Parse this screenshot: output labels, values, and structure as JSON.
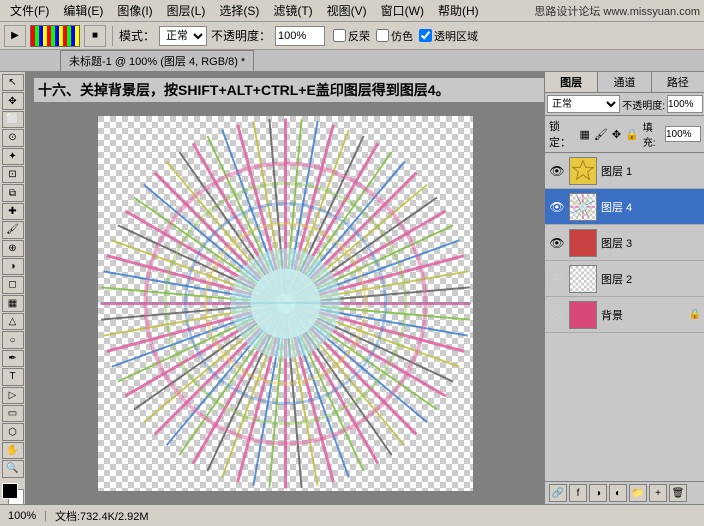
{
  "menubar": {
    "items": [
      "文件(F)",
      "编辑(E)",
      "图像(I)",
      "图层(L)",
      "选择(S)",
      "滤镜(T)",
      "视图(V)",
      "窗口(W)",
      "帮助(H)"
    ],
    "site": "思路设计论坛 www.missyuan.com"
  },
  "toolbar": {
    "mode_label": "模式：",
    "mode_value": "正常",
    "opacity_label": "不透明度：",
    "opacity_value": "100%",
    "checkbox1": "反荣",
    "checkbox2": "仿色",
    "checkbox3": "透明区域"
  },
  "tabbar": {
    "tab": "未标题-1 @ 100% (图层 4, RGB/8) *"
  },
  "instruction": "十六、关掉背景层，按SHIFT+ALT+CTRL+E盖印图层得到图层4。",
  "layers_panel": {
    "tabs": [
      "图层",
      "通道",
      "路径"
    ],
    "active_tab": "图层",
    "blend_mode": "正常",
    "opacity_label": "不透明度：",
    "opacity_value": "100%",
    "lock_label": "锁定：",
    "fill_label": "填充：",
    "fill_value": "100%",
    "layers": [
      {
        "name": "图层 1",
        "visible": true,
        "type": "star",
        "locked": false
      },
      {
        "name": "图层 4",
        "visible": true,
        "type": "layer4",
        "locked": false,
        "active": true
      },
      {
        "name": "图层 3",
        "visible": true,
        "type": "layer3",
        "locked": false
      },
      {
        "name": "图层 2",
        "visible": false,
        "type": "layer2",
        "locked": false
      },
      {
        "name": "背景",
        "visible": false,
        "type": "bg",
        "locked": true
      }
    ]
  },
  "statusbar": {
    "zoom": "100%",
    "doc_size": "文档:732.4K/2.92M"
  },
  "icons": {
    "eye": "👁",
    "lock": "🔒",
    "star": "★",
    "move": "✥",
    "lasso": "⊙",
    "crop": "⊡",
    "brush": "🖌",
    "eraser": "◻",
    "dodge": "○",
    "pen": "✒",
    "text": "T",
    "hand": "✋",
    "zoom": "🔍"
  }
}
